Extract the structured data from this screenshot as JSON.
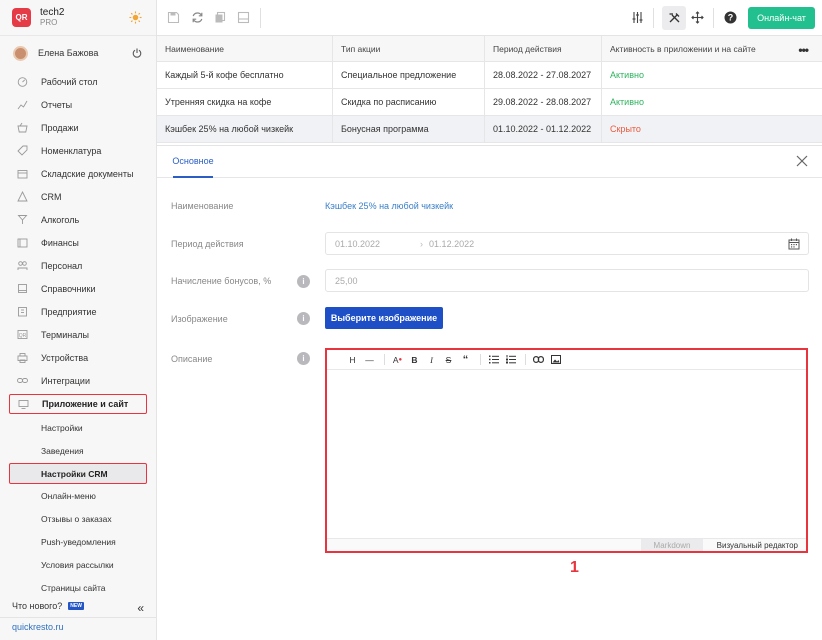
{
  "brand": {
    "name": "tech2",
    "plan": "PRO",
    "logo_text": "QR"
  },
  "user": {
    "name": "Елена Бажова"
  },
  "sidebar": {
    "items": [
      {
        "label": "Рабочий стол",
        "icon": "dashboard-icon"
      },
      {
        "label": "Отчеты",
        "icon": "reports-icon"
      },
      {
        "label": "Продажи",
        "icon": "basket-icon"
      },
      {
        "label": "Номенклатура",
        "icon": "tag-icon"
      },
      {
        "label": "Складские документы",
        "icon": "box-icon"
      },
      {
        "label": "CRM",
        "icon": "crm-icon"
      },
      {
        "label": "Алкоголь",
        "icon": "glass-icon"
      },
      {
        "label": "Финансы",
        "icon": "wallet-icon"
      },
      {
        "label": "Персонал",
        "icon": "people-icon"
      },
      {
        "label": "Справочники",
        "icon": "book-icon"
      },
      {
        "label": "Предприятие",
        "icon": "building-icon"
      },
      {
        "label": "Терминалы",
        "icon": "terminal-icon"
      },
      {
        "label": "Устройства",
        "icon": "printer-icon"
      },
      {
        "label": "Интеграции",
        "icon": "link-icon"
      }
    ],
    "active_group": {
      "label": "Приложение и сайт",
      "icon": "monitor-icon"
    },
    "sub_items": [
      "Настройки",
      "Заведения",
      "Настройки CRM",
      "Онлайн-меню",
      "Отзывы о заказах",
      "Push-уведомления",
      "Условия рассылки",
      "Страницы сайта"
    ],
    "whats_new": "Что нового?",
    "new_badge": "NEW",
    "site_link": "quickresto.ru"
  },
  "topbar": {
    "chat_label": "Онлайн-чат"
  },
  "table": {
    "headers": [
      "Наименование",
      "Тип акции",
      "Период действия",
      "Активность в приложении и на сайте"
    ],
    "rows": [
      {
        "name": "Каждый 5-й кофе бесплатно",
        "type": "Специальное предложение",
        "period": "28.08.2022 - 27.08.2027",
        "status": "Активно"
      },
      {
        "name": "Утренняя скидка на кофе",
        "type": "Скидка по расписанию",
        "period": "29.08.2022 - 28.08.2027",
        "status": "Активно"
      },
      {
        "name": "Кэшбек 25% на любой чизкейк",
        "type": "Бонусная программа",
        "period": "01.10.2022 - 01.12.2022",
        "status": "Скрыто"
      }
    ]
  },
  "panel": {
    "tab": "Основное",
    "fields": {
      "name_label": "Наименование",
      "name_value": "Кэшбек 25% на любой чизкейк",
      "period_label": "Период действия",
      "period_from": "01.10.2022",
      "period_to": "01.12.2022",
      "bonus_label": "Начисление бонусов, %",
      "bonus_value": "25,00",
      "image_label": "Изображение",
      "image_button": "Выберите изображение",
      "description_label": "Описание"
    },
    "editor": {
      "toolbar": [
        "H",
        "—",
        "A",
        "B",
        "I",
        "S",
        "“",
        "list-icon",
        "ordered-list-icon",
        "link-icon",
        "image-icon"
      ],
      "mode_markdown": "Markdown",
      "mode_visual": "Визуальный редактор"
    }
  },
  "annotation": "1",
  "colors": {
    "accent": "#1f4fc7",
    "chat": "#22c08e",
    "highlight": "#e8343e",
    "active_status": "#2db35d",
    "hidden_status": "#ea5a3e"
  }
}
